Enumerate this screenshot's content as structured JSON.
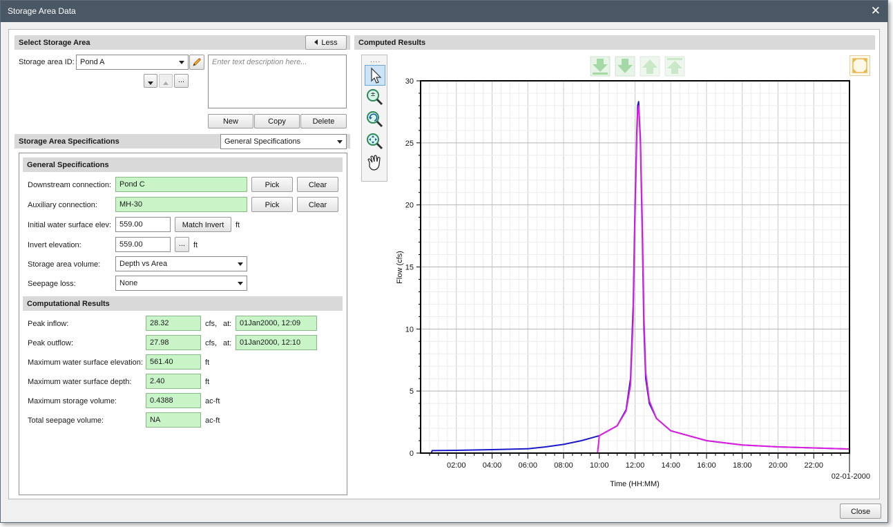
{
  "window": {
    "title": "Storage Area Data",
    "close_label": "Close"
  },
  "select_storage": {
    "header": "Select Storage Area",
    "less_label": "Less",
    "id_label": "Storage area ID:",
    "id_value": "Pond A",
    "description_placeholder": "Enter text description here...",
    "browse_label": "...",
    "new_label": "New",
    "copy_label": "Copy",
    "delete_label": "Delete"
  },
  "specs": {
    "header": "Storage Area Specifications",
    "view_select": "General Specifications",
    "general_header": "General Specifications",
    "rows": {
      "downstream_label": "Downstream connection:",
      "downstream_value": "Pond C",
      "auxiliary_label": "Auxiliary connection:",
      "auxiliary_value": "MH-30",
      "pick_label": "Pick",
      "clear_label": "Clear",
      "initial_ws_label": "Initial water surface elev:",
      "initial_ws_value": "559.00",
      "match_invert_label": "Match Invert",
      "invert_label": "Invert elevation:",
      "invert_value": "559.00",
      "invert_browse": "...",
      "unit_ft": "ft",
      "volume_label": "Storage area volume:",
      "volume_value": "Depth vs Area",
      "seepage_label": "Seepage loss:",
      "seepage_value": "None"
    },
    "results_header": "Computational Results",
    "results": {
      "peak_inflow_label": "Peak inflow:",
      "peak_inflow_value": "28.32",
      "peak_inflow_time": "01Jan2000, 12:09",
      "peak_outflow_label": "Peak outflow:",
      "peak_outflow_value": "27.98",
      "peak_outflow_time": "01Jan2000, 12:10",
      "cfs_label": "cfs,",
      "at_label": "at:",
      "max_wse_label": "Maximum water surface elevation:",
      "max_wse_value": "561.40",
      "max_depth_label": "Maximum water surface depth:",
      "max_depth_value": "2.40",
      "max_storage_label": "Maximum storage volume:",
      "max_storage_value": "0.4388",
      "seepage_vol_label": "Total seepage volume:",
      "seepage_vol_value": "NA",
      "unit_ft": "ft",
      "unit_acft": "ac-ft"
    }
  },
  "computed": {
    "header": "Computed Results",
    "toolbar": [
      "select-arrow-icon",
      "zoom-in-out-icon",
      "zoom-previous-icon",
      "zoom-extents-icon",
      "pan-hand-icon"
    ],
    "nav_buttons": [
      "first-icon",
      "down-icon",
      "up-icon",
      "last-icon"
    ],
    "grip": "....",
    "date_caption": "02-01-2000"
  },
  "chart_data": {
    "type": "line",
    "xlabel": "Time (HH:MM)",
    "ylabel": "Flow (cfs)",
    "xlim": [
      0,
      24
    ],
    "ylim": [
      0,
      30
    ],
    "x_ticks": [
      "02:00",
      "04:00",
      "06:00",
      "08:00",
      "10:00",
      "12:00",
      "14:00",
      "16:00",
      "18:00",
      "20:00",
      "22:00"
    ],
    "y_ticks": [
      "0",
      "5",
      "10",
      "15",
      "20",
      "25",
      "30"
    ],
    "grid": true,
    "series": [
      {
        "color": "#1a1acc",
        "x": [
          0,
          0.6,
          0.65,
          2,
          4,
          6,
          7,
          8,
          9,
          10,
          11,
          11.5,
          11.75,
          11.9,
          12.0,
          12.1,
          12.15,
          12.2,
          12.3,
          12.4,
          12.5,
          12.6,
          12.8,
          13.2,
          14,
          16,
          18,
          20,
          22,
          24
        ],
        "y": [
          0,
          0,
          0.2,
          0.22,
          0.28,
          0.35,
          0.5,
          0.7,
          1.0,
          1.4,
          2.2,
          3.5,
          6,
          12,
          20,
          26,
          28,
          28.32,
          25,
          18,
          10,
          6,
          4,
          2.8,
          1.8,
          1.0,
          0.65,
          0.5,
          0.42,
          0.33
        ]
      },
      {
        "color": "#e020e0",
        "x": [
          0,
          9.9,
          10.0,
          11,
          11.5,
          11.75,
          11.9,
          12.0,
          12.1,
          12.15,
          12.2,
          12.3,
          12.4,
          12.5,
          12.6,
          12.8,
          13.2,
          14,
          16,
          18,
          20,
          22,
          24
        ],
        "y": [
          0,
          0,
          1.4,
          2.2,
          3.4,
          5.5,
          11,
          19,
          25.5,
          27.5,
          27.98,
          25.5,
          19,
          11,
          6.5,
          4.2,
          2.8,
          1.8,
          1.0,
          0.65,
          0.5,
          0.42,
          0.33
        ]
      }
    ]
  }
}
